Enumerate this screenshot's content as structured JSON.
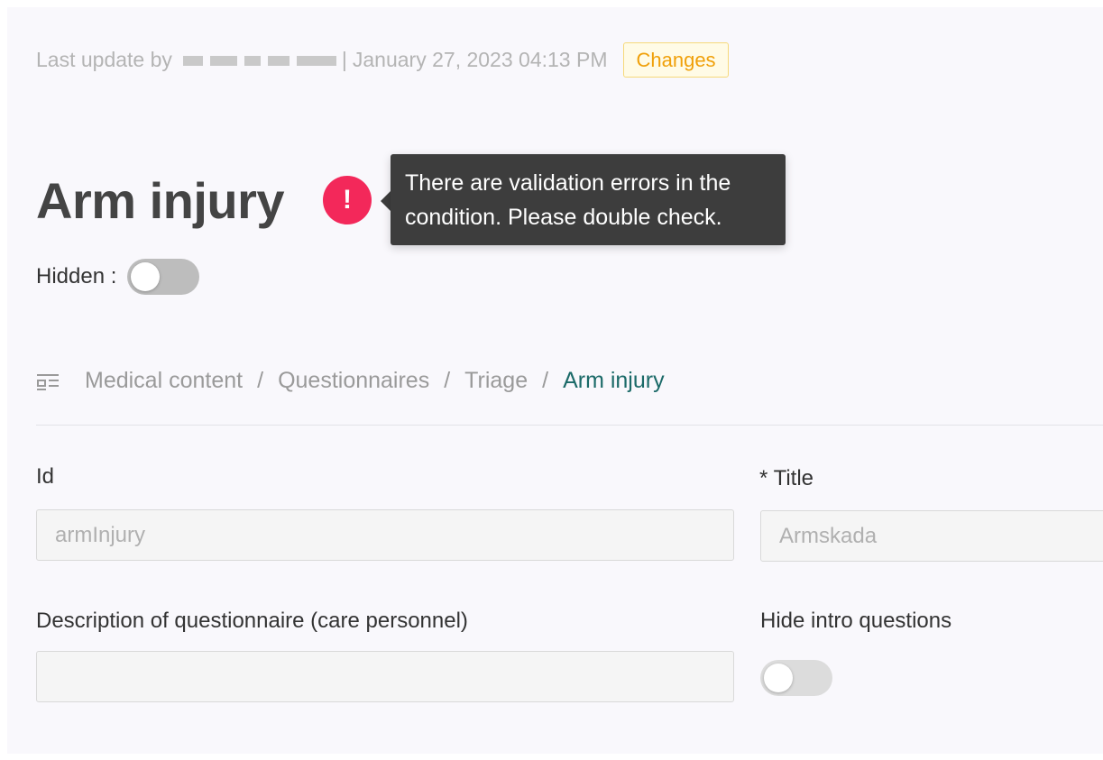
{
  "header": {
    "last_update_prefix": "Last update by",
    "separator": "|",
    "timestamp": "January 27, 2023 04:13 PM",
    "changes_label": "Changes"
  },
  "title": {
    "text": "Arm injury",
    "error_tooltip": "There are validation errors in the condition. Please double check."
  },
  "hidden": {
    "label": "Hidden :",
    "on": false
  },
  "breadcrumb": {
    "icon": "list-icon",
    "items": [
      "Medical content",
      "Questionnaires",
      "Triage"
    ],
    "current": "Arm injury",
    "separator": "/"
  },
  "form": {
    "id_label": "Id",
    "id_value": "armInjury",
    "title_label": "* Title",
    "title_value": "Armskada",
    "description_label": "Description of questionnaire (care personnel)",
    "description_value": "",
    "hide_intro_label": "Hide intro questions",
    "hide_intro_on": false
  },
  "colors": {
    "accent": "#1b6a68",
    "error": "#f3285a",
    "badge_text": "#f0a00a",
    "badge_bg": "#fffbe6"
  }
}
